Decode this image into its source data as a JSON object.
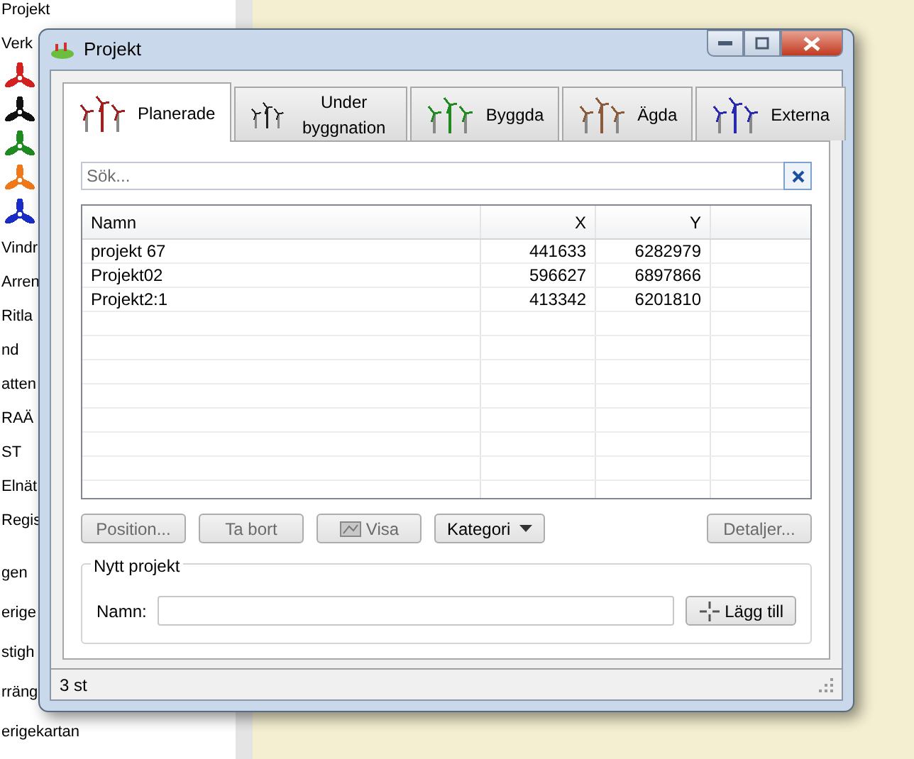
{
  "sidebar": {
    "sections": [
      {
        "items": [
          {
            "kind": "text",
            "label": "Projekt"
          },
          {
            "kind": "text",
            "label": "Verk"
          },
          {
            "kind": "turbine",
            "color": "#d42020"
          },
          {
            "kind": "turbine",
            "color": "#111111"
          },
          {
            "kind": "turbine",
            "color": "#1f8a1f"
          },
          {
            "kind": "turbine",
            "color": "#f07818"
          },
          {
            "kind": "turbine",
            "color": "#1a2cc8"
          },
          {
            "kind": "text",
            "label": "Vindr"
          },
          {
            "kind": "text",
            "label": "Arren"
          },
          {
            "kind": "text",
            "label": "Ritla"
          },
          {
            "kind": "text",
            "label": "nd"
          },
          {
            "kind": "text",
            "label": "atten"
          },
          {
            "kind": "text",
            "label": "RAÄ"
          },
          {
            "kind": "text",
            "label": "ST"
          },
          {
            "kind": "text",
            "label": "Elnät"
          },
          {
            "kind": "text",
            "label": "Regis"
          }
        ]
      },
      {
        "items": [
          {
            "kind": "text",
            "label": "gen"
          },
          {
            "kind": "text",
            "label": "erige"
          },
          {
            "kind": "text",
            "label": "stigh"
          },
          {
            "kind": "text",
            "label": "rräng"
          },
          {
            "kind": "text",
            "label": "erigekartan"
          }
        ]
      }
    ]
  },
  "window": {
    "title": "Projekt",
    "tabs": [
      {
        "label": "Planerade",
        "selected": true,
        "color": "#a02020"
      },
      {
        "label": "Under byggnation",
        "selected": false,
        "color": "#222222"
      },
      {
        "label": "Byggda",
        "selected": false,
        "color": "#1f8a1f"
      },
      {
        "label": "Ägda",
        "selected": false,
        "color": "#8a5a3a"
      },
      {
        "label": "Externa",
        "selected": false,
        "color": "#2a2ab0"
      }
    ],
    "search": {
      "placeholder": "Sök..."
    },
    "table": {
      "columns": [
        "Namn",
        "X",
        "Y"
      ],
      "rows": [
        [
          "projekt 67",
          "441633",
          "6282979"
        ],
        [
          "Projekt02",
          "596627",
          "6897866"
        ],
        [
          "Projekt2:1",
          "413342",
          "6201810"
        ]
      ]
    },
    "buttons": [
      {
        "kind": "plain",
        "label": "Position...",
        "disabled": true
      },
      {
        "kind": "plain",
        "label": "Ta bort",
        "disabled": true
      },
      {
        "kind": "icon",
        "label": "Visa",
        "disabled": true
      },
      {
        "kind": "dropdown",
        "label": "Kategori",
        "disabled": false
      },
      {
        "kind": "right",
        "label": "Detaljer...",
        "disabled": true
      }
    ],
    "new_project": {
      "title": "Nytt projekt",
      "label": "Namn:",
      "button": "Lägg till"
    },
    "status_bar": "3 st"
  }
}
